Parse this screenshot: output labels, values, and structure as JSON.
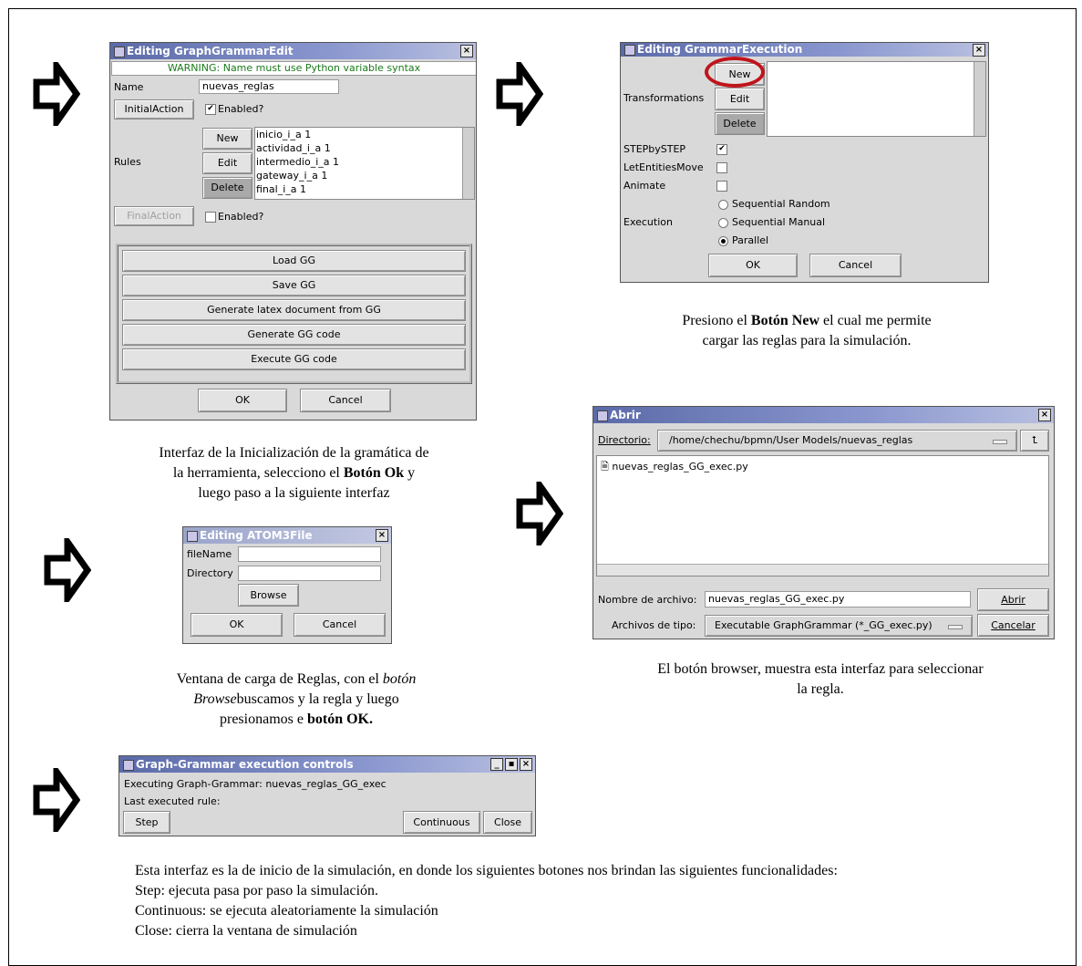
{
  "win1": {
    "title": "Editing GraphGrammarEdit",
    "warning": "WARNING: Name must use Python variable syntax",
    "name_label": "Name",
    "name_value": "nuevas_reglas",
    "initial_action": "InitialAction",
    "enabled1": "Enabled?",
    "rules_label": "Rules",
    "new": "New",
    "edit": "Edit",
    "delete": "Delete",
    "rules": [
      "inicio_i_a 1",
      "actividad_i_a 1",
      "intermedio_i_a 1",
      "gateway_i_a 1",
      "final_i_a 1"
    ],
    "final_action": "FinalAction",
    "enabled2": "Enabled?",
    "load": "Load GG",
    "save": "Save GG",
    "latex": "Generate latex document from GG",
    "gen_code": "Generate GG code",
    "exec_code": "Execute GG code",
    "ok": "OK",
    "cancel": "Cancel"
  },
  "win2": {
    "title": "Editing GrammarExecution",
    "transformations": "Transformations",
    "new": "New",
    "edit": "Edit",
    "delete": "Delete",
    "step": "STEPbySTEP",
    "move": "LetEntitiesMove",
    "animate": "Animate",
    "execution": "Execution",
    "opt1": "Sequential Random",
    "opt2": "Sequential Manual",
    "opt3": "Parallel",
    "ok": "OK",
    "cancel": "Cancel"
  },
  "win3": {
    "title": "Editing ATOM3File",
    "filename": "fileName",
    "directory": "Directory",
    "browse": "Browse",
    "ok": "OK",
    "cancel": "Cancel"
  },
  "win4": {
    "title": "Abrir",
    "dir_label": "Directorio:",
    "dir_value": "/home/chechu/bpmn/User Models/nuevas_reglas",
    "file_item": "nuevas_reglas_GG_exec.py",
    "filename_label": "Nombre de archivo:",
    "filename_value": "nuevas_reglas_GG_exec.py",
    "open": "Abrir",
    "type_label": "Archivos de tipo:",
    "type_value": "Executable GraphGrammar (*_GG_exec.py)",
    "cancel": "Cancelar"
  },
  "win5": {
    "title": "Graph-Grammar execution controls",
    "executing": "Executing Graph-Grammar:  nuevas_reglas_GG_exec",
    "last": "Last executed rule:",
    "step": "Step",
    "continuous": "Continuous",
    "close": "Close"
  },
  "captions": {
    "c1_a": "Interfaz de la Inicialización de la gramática de",
    "c1_b": "la herramienta, selecciono el ",
    "c1_b_bold": "Botón Ok",
    "c1_b_end": "  y",
    "c1_c": "luego paso a la siguiente interfaz",
    "c2_a": "Presiono el ",
    "c2_a_bold": "Botón New",
    "c2_a_end": " el cual me permite",
    "c2_b": "cargar las reglas para la simulación.",
    "c3_a": "Ventana de carga de Reglas, con el ",
    "c3_a_it": "botón",
    "c3_b_it": "Browse",
    "c3_b": "buscamos y  la regla y luego",
    "c3_c": "presionamos e ",
    "c3_c_bold": "botón OK.",
    "c4_a": "El botón browser, muestra esta interfaz para seleccionar",
    "c4_b": "la regla.",
    "c5_a": "Esta interfaz es la de inicio de la simulación, en donde los siguientes botones nos brindan las siguientes funcionalidades:",
    "c5_b": "Step: ejecuta pasa por paso la simulación.",
    "c5_c": "Continuous: se ejecuta aleatoriamente la simulación",
    "c5_d": "Close: cierra la ventana de simulación"
  }
}
